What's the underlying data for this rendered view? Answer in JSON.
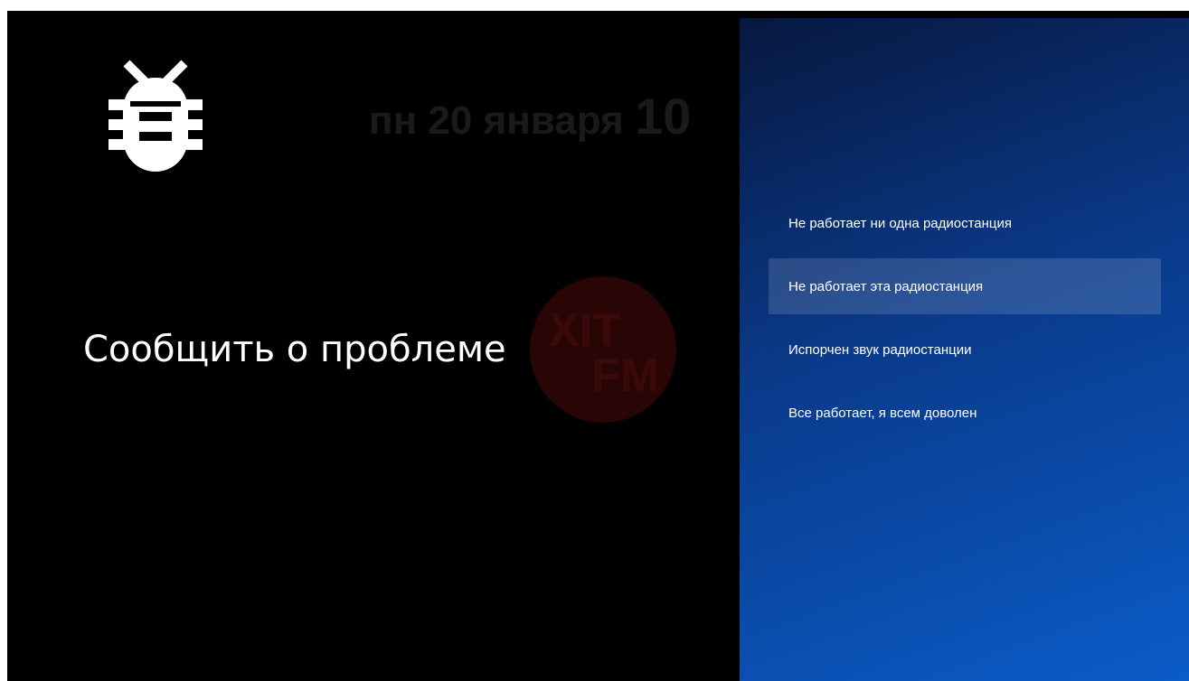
{
  "background": {
    "date": "пн 20 января",
    "time": "10",
    "logo_line1": "XIT",
    "logo_line2": "FM"
  },
  "dialog": {
    "icon": "bug-icon",
    "title": "Сообщить о проблеме"
  },
  "menu": {
    "items": [
      {
        "label": "Не работает ни одна радиостанция",
        "selected": false
      },
      {
        "label": "Не работает эта радиостанция",
        "selected": true
      },
      {
        "label": "Испорчен звук радиостанции",
        "selected": false
      },
      {
        "label": "Все работает, я всем доволен",
        "selected": false
      }
    ]
  },
  "colors": {
    "panel_start": "#07183f",
    "panel_end": "#0b5cc8",
    "highlight": "rgba(255,255,255,0.14)"
  }
}
